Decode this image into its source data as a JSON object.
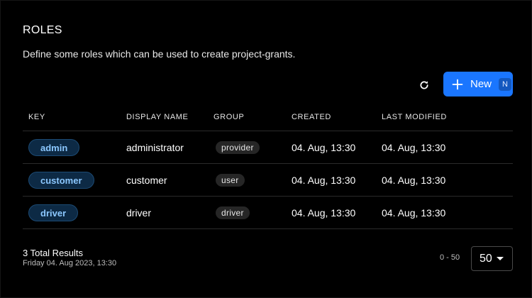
{
  "header": {
    "title": "ROLES",
    "description": "Define some roles which can be used to create project-grants."
  },
  "toolbar": {
    "refresh_icon": "refresh-icon",
    "new_label": "New",
    "new_shortcut": "N",
    "new_icon": "plus-icon",
    "accent": "#1a76ff"
  },
  "table": {
    "columns": [
      "KEY",
      "DISPLAY NAME",
      "GROUP",
      "CREATED",
      "LAST MODIFIED"
    ],
    "rows": [
      {
        "key": "admin",
        "display_name": "administrator",
        "group": "provider",
        "created": "04. Aug, 13:30",
        "modified": "04. Aug, 13:30"
      },
      {
        "key": "customer",
        "display_name": "customer",
        "group": "user",
        "created": "04. Aug, 13:30",
        "modified": "04. Aug, 13:30"
      },
      {
        "key": "driver",
        "display_name": "driver",
        "group": "driver",
        "created": "04. Aug, 13:30",
        "modified": "04. Aug, 13:30"
      }
    ]
  },
  "footer": {
    "total": "3 Total Results",
    "date": "Friday 04. Aug 2023, 13:30",
    "range": "0 - 50",
    "page_size": "50",
    "caret_icon": "caret-down-icon"
  }
}
